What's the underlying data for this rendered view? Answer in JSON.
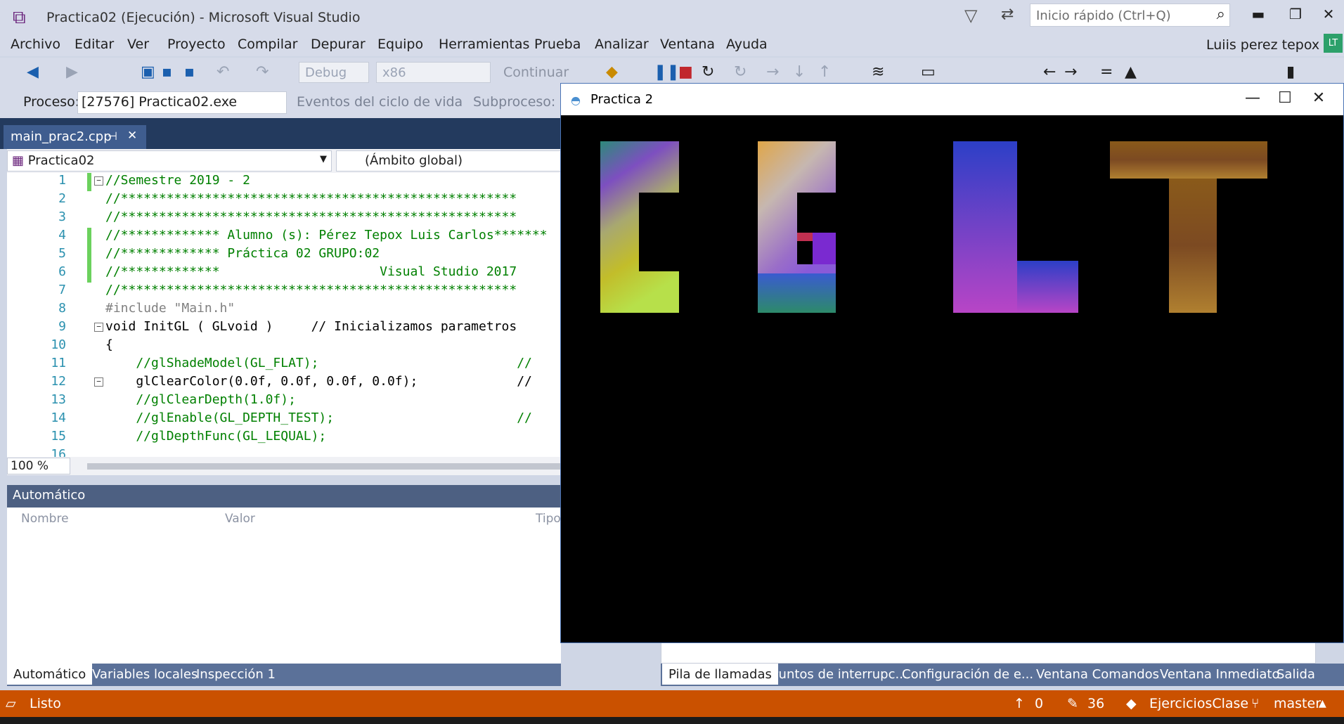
{
  "window": {
    "title": "Practica02 (Ejecución) - Microsoft Visual Studio"
  },
  "quick_launch": {
    "placeholder": "Inicio rápido (Ctrl+Q)"
  },
  "window_controls": {
    "minimize": "▬",
    "restore": "❐",
    "close": "✕"
  },
  "menu": [
    "Archivo",
    "Editar",
    "Ver",
    "Proyecto",
    "Compilar",
    "Depurar",
    "Equipo",
    "Herramientas",
    "Prueba",
    "Analizar",
    "Ventana",
    "Ayuda"
  ],
  "user": {
    "name": "Luiis perez tepox",
    "initials": "LT"
  },
  "toolbar": {
    "config": "Debug",
    "platform": "x86",
    "continue": "Continuar"
  },
  "process_bar": {
    "label": "Proceso:",
    "process": "[27576] Practica02.exe",
    "events": "Eventos del ciclo de vida",
    "thread": "Subproceso:"
  },
  "document_tab": {
    "name": "main_prac2.cpp",
    "pin": "⊣",
    "close": "✕"
  },
  "navigation": {
    "project": "Practica02",
    "scope": "(Ámbito global)"
  },
  "code_lines": [
    {
      "n": "1",
      "t": "//Semestre 2019 - 2"
    },
    {
      "n": "2",
      "t": "//****************************************************"
    },
    {
      "n": "3",
      "t": "//****************************************************"
    },
    {
      "n": "4",
      "t": "//************* Alumno (s): Pérez Tepox Luis Carlos*******"
    },
    {
      "n": "5",
      "t": "//************* Práctica 02 GRUPO:02"
    },
    {
      "n": "6",
      "t": "//*************                     Visual Studio 2017"
    },
    {
      "n": "7",
      "t": "//****************************************************"
    },
    {
      "n": "8",
      "t": "#include \"Main.h\""
    },
    {
      "n": "9",
      "t": "void InitGL ( GLvoid )     // Inicializamos parametros"
    },
    {
      "n": "10",
      "t": "{"
    },
    {
      "n": "11",
      "t": "    //glShadeModel(GL_FLAT);                          //"
    },
    {
      "n": "12",
      "t": "    glClearColor(0.0f, 0.0f, 0.0f, 0.0f);             //"
    },
    {
      "n": "13",
      "t": "    //glClearDepth(1.0f);"
    },
    {
      "n": "14",
      "t": "    //glEnable(GL_DEPTH_TEST);                        //"
    },
    {
      "n": "15",
      "t": "    //glDepthFunc(GL_LEQUAL);"
    },
    {
      "n": "16",
      "t": ""
    }
  ],
  "zoom": "100 %",
  "autos": {
    "title": "Automático",
    "columns": [
      "Nombre",
      "Valor",
      "Tipo"
    ]
  },
  "bottom_tabs_left": [
    "Automático",
    "Variables locales",
    "Inspección 1"
  ],
  "bottom_tabs_right": [
    "Pila de llamadas",
    "Puntos de interrupc...",
    "Configuración de e...",
    "Ventana Comandos",
    "Ventana Inmediato",
    "Salida"
  ],
  "status": {
    "ready": "Listo",
    "up": "0",
    "edits": "36",
    "repo": "EjerciciosClase",
    "branch": "master"
  },
  "gl_window": {
    "title": "Practica 2",
    "minimize": "—",
    "maximize": "☐",
    "close": "✕"
  },
  "icons": [
    "vs-logo-icon",
    "filter-icon",
    "feedback-icon",
    "search-icon",
    "back-icon",
    "forward-icon",
    "save-icon",
    "save-all-icon",
    "undo-icon",
    "redo-icon",
    "pause-icon",
    "stop-icon",
    "restart-icon",
    "pin-icon",
    "close-icon",
    "source-control-icon",
    "branch-icon",
    "pencil-icon",
    "up-arrow-icon",
    "gl-app-icon"
  ],
  "colors": {
    "accent_status": "#ca5100",
    "tab_active": "#3f5d8f",
    "editor_comment": "#008000",
    "keyword": "#0000ff"
  }
}
